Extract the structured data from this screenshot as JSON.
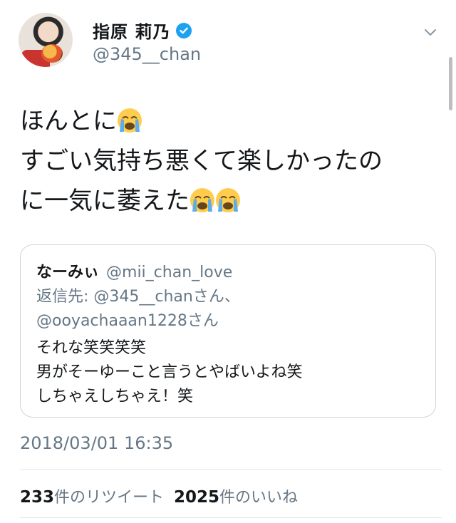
{
  "user": {
    "display_name": "指原 莉乃",
    "handle": "@345__chan",
    "verified_icon": "verified-badge-icon",
    "avatar_icon": "profile-avatar"
  },
  "tweet": {
    "lines": [
      "ほんとに",
      "すごい気持ち悪くて楽しかったの",
      "に一気に萎えた"
    ],
    "emoji": "loudly-crying-face"
  },
  "quoted_tweet": {
    "name": "なーみぃ",
    "handle": "@mii_chan_love",
    "reply_line1": "返信先: @345__chanさん、",
    "reply_line2": "@ooyachaaan1228さん",
    "body": [
      "それな笑笑笑笑",
      "男がそーゆーこと言うとやばいよね笑",
      "しちゃえしちゃえ！笑"
    ]
  },
  "timestamp": "2018/03/01 16:35",
  "stats": {
    "retweet_count": "233",
    "retweet_label": "件のリツイート",
    "like_count": "2025",
    "like_label": "件のいいね"
  },
  "colors": {
    "accent": "#1da1f2",
    "secondary_text": "#657786",
    "border": "#ccd6dd"
  }
}
